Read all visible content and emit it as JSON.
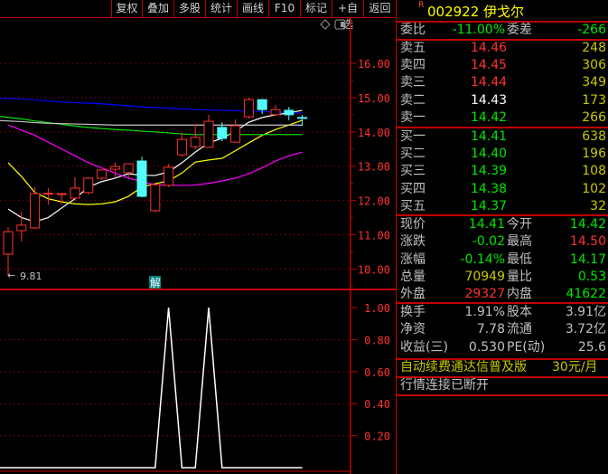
{
  "toolbar": [
    "复权",
    "叠加",
    "多股",
    "统计",
    "画线",
    "F10",
    "标记",
    "+自选",
    "返回"
  ],
  "stock": {
    "flag": "R",
    "code_name": "002922 伊戈尔"
  },
  "weibi": {
    "label1": "委比",
    "value1": "-11.00%",
    "label2": "委差",
    "value2": "-266"
  },
  "sell": [
    {
      "label": "卖五",
      "price": "14.46",
      "vol": "248",
      "color": "r"
    },
    {
      "label": "卖四",
      "price": "14.45",
      "vol": "306",
      "color": "r"
    },
    {
      "label": "卖三",
      "price": "14.44",
      "vol": "349",
      "color": "r"
    },
    {
      "label": "卖二",
      "price": "14.43",
      "vol": "173",
      "color": "w"
    },
    {
      "label": "卖一",
      "price": "14.42",
      "vol": "266",
      "color": "g"
    }
  ],
  "buy": [
    {
      "label": "买一",
      "price": "14.41",
      "vol": "638",
      "color": "g"
    },
    {
      "label": "买二",
      "price": "14.40",
      "vol": "196",
      "color": "g"
    },
    {
      "label": "买三",
      "price": "14.39",
      "vol": "108",
      "color": "g"
    },
    {
      "label": "买四",
      "price": "14.38",
      "vol": "102",
      "color": "g"
    },
    {
      "label": "买五",
      "price": "14.37",
      "vol": "32",
      "color": "g"
    }
  ],
  "quote": [
    {
      "l1": "现价",
      "v1": "14.41",
      "c1": "g",
      "l2": "今开",
      "v2": "14.42",
      "c2": "g"
    },
    {
      "l1": "涨跌",
      "v1": "-0.02",
      "c1": "g",
      "l2": "最高",
      "v2": "14.50",
      "c2": "r"
    },
    {
      "l1": "涨幅",
      "v1": "-0.14%",
      "c1": "g",
      "l2": "最低",
      "v2": "14.17",
      "c2": "g"
    },
    {
      "l1": "总量",
      "v1": "70949",
      "c1": "y",
      "l2": "量比",
      "v2": "0.53",
      "c2": "g"
    },
    {
      "l1": "外盘",
      "v1": "29327",
      "c1": "r",
      "l2": "内盘",
      "v2": "41622",
      "c2": "g"
    }
  ],
  "finance": [
    {
      "l1": "换手",
      "v1": "1.91%",
      "c1": "gr",
      "l2": "股本",
      "v2": "3.91亿",
      "c2": "gr"
    },
    {
      "l1": "净资",
      "v1": "7.78",
      "c1": "gr",
      "l2": "流通",
      "v2": "3.72亿",
      "c2": "gr"
    },
    {
      "l1": "收益(三)",
      "v1": "0.530",
      "c1": "gr",
      "l2": "PE(动)",
      "v2": "25.6",
      "c2": "gr"
    }
  ],
  "ad": {
    "text": "自动续费通达信普及版",
    "price": "30元/月"
  },
  "status": "行情连接已断开",
  "chart_data": [
    {
      "type": "candlestick",
      "ylim": [
        9.6,
        16.7
      ],
      "yticks": [
        "16.00",
        "15.00",
        "14.00",
        "13.00",
        "12.00",
        "11.00",
        "10.00"
      ],
      "min_label": "9.81",
      "badge": "解",
      "candles": [
        [
          10.43,
          11.22,
          9.81,
          11.09
        ],
        [
          11.12,
          11.67,
          10.8,
          11.28
        ],
        [
          11.2,
          12.39,
          11.17,
          12.2
        ],
        [
          12.19,
          12.36,
          11.88,
          12.21
        ],
        [
          12.2,
          12.2,
          11.88,
          12.2
        ],
        [
          12.07,
          12.68,
          11.99,
          12.36
        ],
        [
          12.23,
          12.68,
          12.17,
          12.65
        ],
        [
          12.65,
          12.89,
          12.6,
          12.89
        ],
        [
          12.91,
          13.1,
          12.68,
          12.99
        ],
        [
          12.81,
          13.07,
          12.65,
          13.07
        ],
        [
          13.15,
          13.28,
          12.09,
          12.12
        ],
        [
          11.7,
          12.46,
          11.65,
          12.46
        ],
        [
          12.44,
          13.07,
          12.39,
          12.97
        ],
        [
          13.33,
          13.97,
          13.28,
          13.78
        ],
        [
          13.57,
          14.23,
          13.49,
          13.84
        ],
        [
          13.55,
          14.5,
          13.55,
          14.31
        ],
        [
          14.13,
          14.28,
          13.73,
          13.81
        ],
        [
          13.7,
          14.36,
          13.7,
          14.18
        ],
        [
          14.44,
          15.0,
          14.39,
          14.94
        ],
        [
          14.94,
          14.96,
          14.52,
          14.65
        ],
        [
          14.5,
          14.79,
          14.5,
          14.65
        ],
        [
          14.63,
          14.73,
          14.34,
          14.5
        ],
        [
          14.42,
          14.5,
          14.17,
          14.41
        ]
      ],
      "ma": [
        {
          "color": "#ffffff",
          "values": [
            11.75,
            11.5,
            11.38,
            11.5,
            11.78,
            12.05,
            12.39,
            12.55,
            12.65,
            12.78,
            12.73,
            12.73,
            12.83,
            13.1,
            13.41,
            13.68,
            13.81,
            14.02,
            14.28,
            14.42,
            14.5,
            14.55,
            14.63
          ]
        },
        {
          "color": "#ffff00",
          "values": [
            13.1,
            12.7,
            12.23,
            12.05,
            11.96,
            11.9,
            11.88,
            11.9,
            11.96,
            12.12,
            12.39,
            12.49,
            12.57,
            12.8,
            13.12,
            13.18,
            13.23,
            13.45,
            13.68,
            13.9,
            14.07,
            14.2,
            14.34
          ]
        },
        {
          "color": "#ff00ff",
          "values": [
            14.2,
            14.05,
            13.9,
            13.7,
            13.5,
            13.3,
            13.1,
            12.95,
            12.8,
            12.65,
            12.55,
            12.46,
            12.44,
            12.44,
            12.45,
            12.5,
            12.57,
            12.65,
            12.78,
            12.95,
            13.15,
            13.3,
            13.41
          ]
        },
        {
          "color": "#00e600",
          "values": [
            14.45,
            14.38,
            14.32,
            14.27,
            14.22,
            14.17,
            14.13,
            14.1,
            14.07,
            14.05,
            14.02,
            14.0,
            13.97,
            13.94,
            13.92,
            13.92,
            13.92,
            13.92,
            13.92,
            13.92,
            13.92,
            13.92,
            13.92
          ]
        },
        {
          "color": "#0000ff",
          "values": [
            14.98,
            14.96,
            14.93,
            14.9,
            14.87,
            14.85,
            14.84,
            14.82,
            14.79,
            14.76,
            14.73,
            14.71,
            14.69,
            14.67,
            14.65,
            14.64,
            14.63,
            14.62,
            14.6,
            14.59,
            14.58,
            14.56,
            14.55
          ]
        },
        {
          "color": "#c8c8c8",
          "values": [
            14.33,
            14.3,
            14.27,
            14.25,
            14.24,
            14.23,
            14.22,
            14.21,
            14.2,
            14.2,
            14.2,
            14.2,
            14.2,
            14.2,
            14.2,
            14.2,
            14.2,
            14.2,
            14.2,
            14.2,
            14.2,
            14.2,
            14.2
          ]
        }
      ]
    },
    {
      "type": "line",
      "ylim": [
        0,
        1.1
      ],
      "yticks": [
        "1.00",
        "0.80",
        "0.60",
        "0.40",
        "0.20"
      ],
      "values": [
        0,
        0,
        0,
        0,
        0,
        0,
        0,
        0,
        0,
        0,
        0,
        0,
        1,
        0,
        0,
        1,
        0,
        0,
        0,
        0,
        0,
        0,
        0
      ]
    }
  ]
}
